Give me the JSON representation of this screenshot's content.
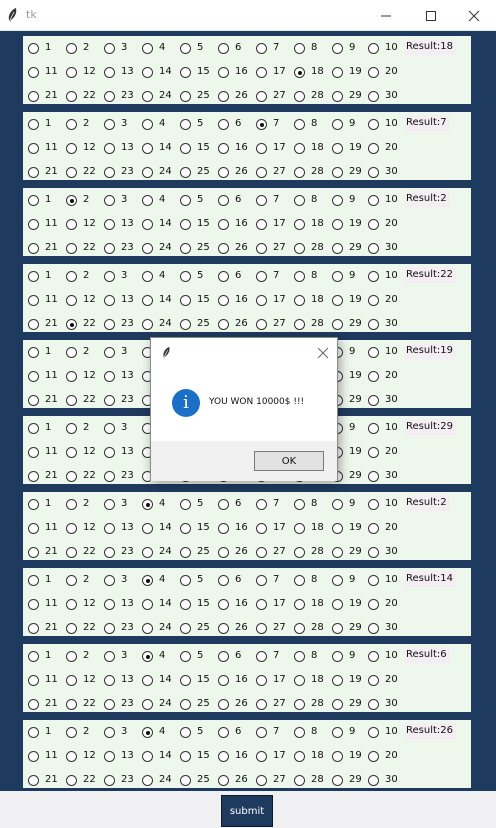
{
  "window": {
    "title": "tk",
    "app_icon": "feather-icon",
    "controls": [
      "minimize-icon",
      "maximize-icon",
      "close-icon"
    ]
  },
  "rows": [
    {
      "result": "Result:18",
      "selected": 18
    },
    {
      "result": "Result:7",
      "selected": 7
    },
    {
      "result": "Result:2",
      "selected": 2
    },
    {
      "result": "Result:22",
      "selected": 22
    },
    {
      "result": "Result:19",
      "selected": null
    },
    {
      "result": "Result:29",
      "selected": null
    },
    {
      "result": "Result:2",
      "selected": 4
    },
    {
      "result": "Result:14",
      "selected": 4
    },
    {
      "result": "Result:6",
      "selected": 4
    },
    {
      "result": "Result:26",
      "selected": 4
    }
  ],
  "numbers": [
    "1",
    "2",
    "3",
    "4",
    "5",
    "6",
    "7",
    "8",
    "9",
    "10",
    "11",
    "12",
    "13",
    "14",
    "15",
    "16",
    "17",
    "18",
    "19",
    "20",
    "21",
    "22",
    "23",
    "24",
    "25",
    "26",
    "27",
    "28",
    "29",
    "30"
  ],
  "submit_label": "submit",
  "dialog": {
    "icon": "info-icon",
    "message": "YOU WON 10000$ !!!",
    "ok_label": "OK"
  },
  "colors": {
    "background": "#1f3a5f",
    "panel": "#eef7ec",
    "result_bg": "#f4eef4",
    "info_icon": "#1c6fc6"
  }
}
